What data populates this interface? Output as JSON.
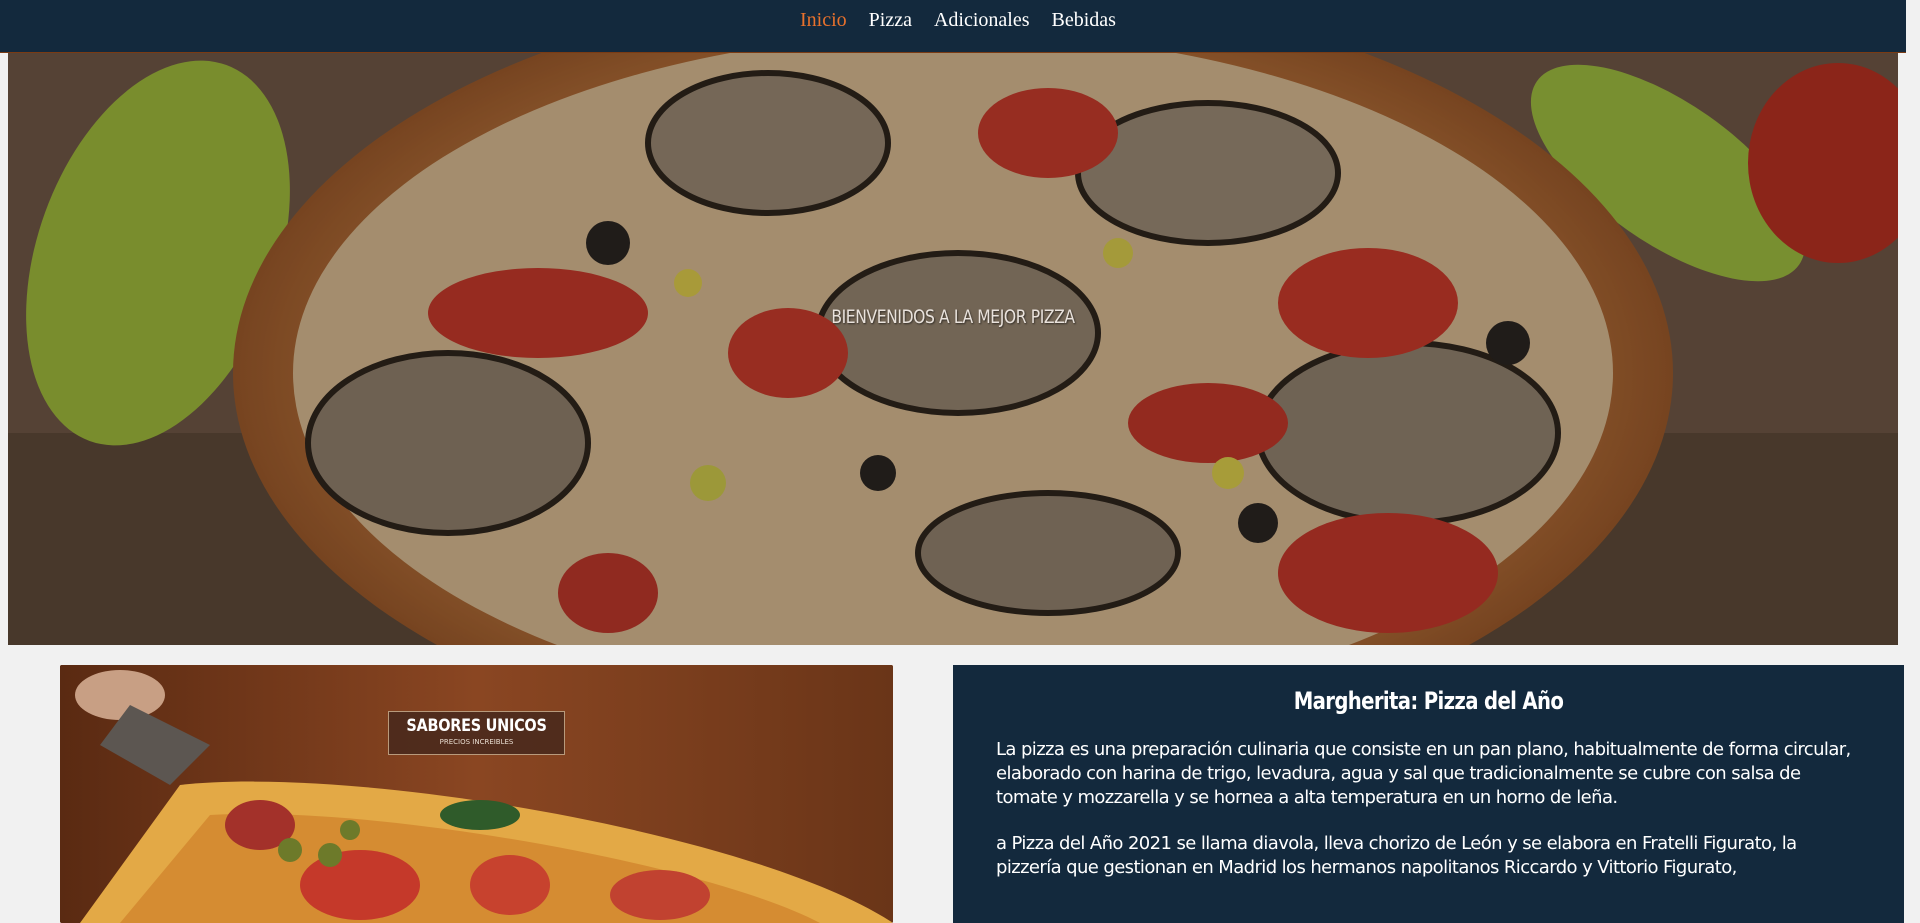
{
  "nav": {
    "items": [
      {
        "label": "Inicio",
        "active": true
      },
      {
        "label": "Pizza",
        "active": false
      },
      {
        "label": "Adicionales",
        "active": false
      },
      {
        "label": "Bebidas",
        "active": false
      }
    ]
  },
  "hero": {
    "title": "BIENVENIDOS A LA MEJOR PIZZA"
  },
  "promo": {
    "title": "SABORES UNICOS",
    "subtitle": "PRECIOS INCREIBLES"
  },
  "info": {
    "title": "Margherita: Pizza del Año",
    "paragraph1": "La pizza es una preparación culinaria que consiste en un pan plano, habitualmente de forma circular, elaborado con harina de trigo, levadura, agua y sal que tradicionalmente se cubre con salsa de tomate y mozzarella y se hornea a alta temperatura en un horno de leña.",
    "paragraph2": "a Pizza del Año 2021 se llama diavola, lleva chorizo de León y se elabora en Fratelli Figurato, la pizzería que gestionan en Madrid los hermanos napolitanos Riccardo y Vittorio Figurato,"
  },
  "colors": {
    "navbar": "#13293d",
    "accent": "#e8712c",
    "page_background": "#f1f1f1"
  }
}
